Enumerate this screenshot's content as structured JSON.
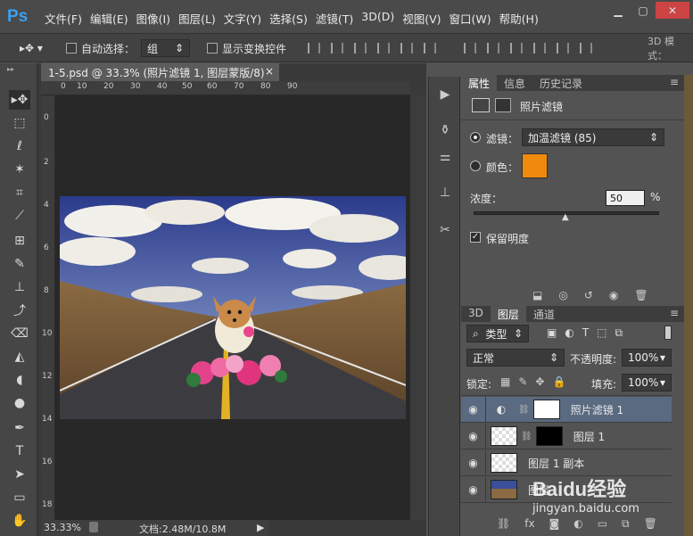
{
  "app": {
    "logo": "Ps"
  },
  "menu": [
    "文件(F)",
    "编辑(E)",
    "图像(I)",
    "图层(L)",
    "文字(Y)",
    "选择(S)",
    "滤镜(T)",
    "3D(D)",
    "视图(V)",
    "窗口(W)",
    "帮助(H)"
  ],
  "options": {
    "auto_select_label": "自动选择：",
    "auto_select_value": "组",
    "show_transform_label": "显示变换控件",
    "mode_3d": "3D 模式："
  },
  "document": {
    "tab_title": "1-5.psd @ 33.3% (照片滤镜 1, 图层蒙版/8)",
    "close": "×",
    "ruler_h": [
      "0",
      "10",
      "20",
      "30",
      "40",
      "50",
      "60",
      "70",
      "80",
      "90"
    ],
    "ruler_v": [
      "0",
      "2",
      "4",
      "6",
      "8",
      "10",
      "12",
      "14",
      "16",
      "18"
    ],
    "zoom": "33.33%",
    "doc_size": "文档:2.48M/10.8M"
  },
  "properties": {
    "tabs": [
      "属性",
      "信息",
      "历史记录"
    ],
    "title": "照片滤镜",
    "filter_label": "滤镜：",
    "filter_value": "加温滤镜 (85)",
    "color_label": "颜色：",
    "color_value": "#ef8a0c",
    "density_label": "浓度：",
    "density_value": "50",
    "density_unit": "%",
    "density_level": 0.5,
    "preserve_label": "保留明度"
  },
  "layers": {
    "tabs": [
      "3D",
      "图层",
      "通道"
    ],
    "filter_kind": "类型",
    "blend_mode": "正常",
    "opacity_label": "不透明度:",
    "opacity_value": "100%",
    "lock_label": "锁定:",
    "fill_label": "填充:",
    "fill_value": "100%",
    "rows": [
      {
        "name": "照片滤镜 1"
      },
      {
        "name": "图层 1"
      },
      {
        "name": "图层 1 副本"
      },
      {
        "name": "图层"
      }
    ]
  },
  "watermark": {
    "brand": "Baidu经验",
    "url": "jingyan.baidu.com"
  }
}
